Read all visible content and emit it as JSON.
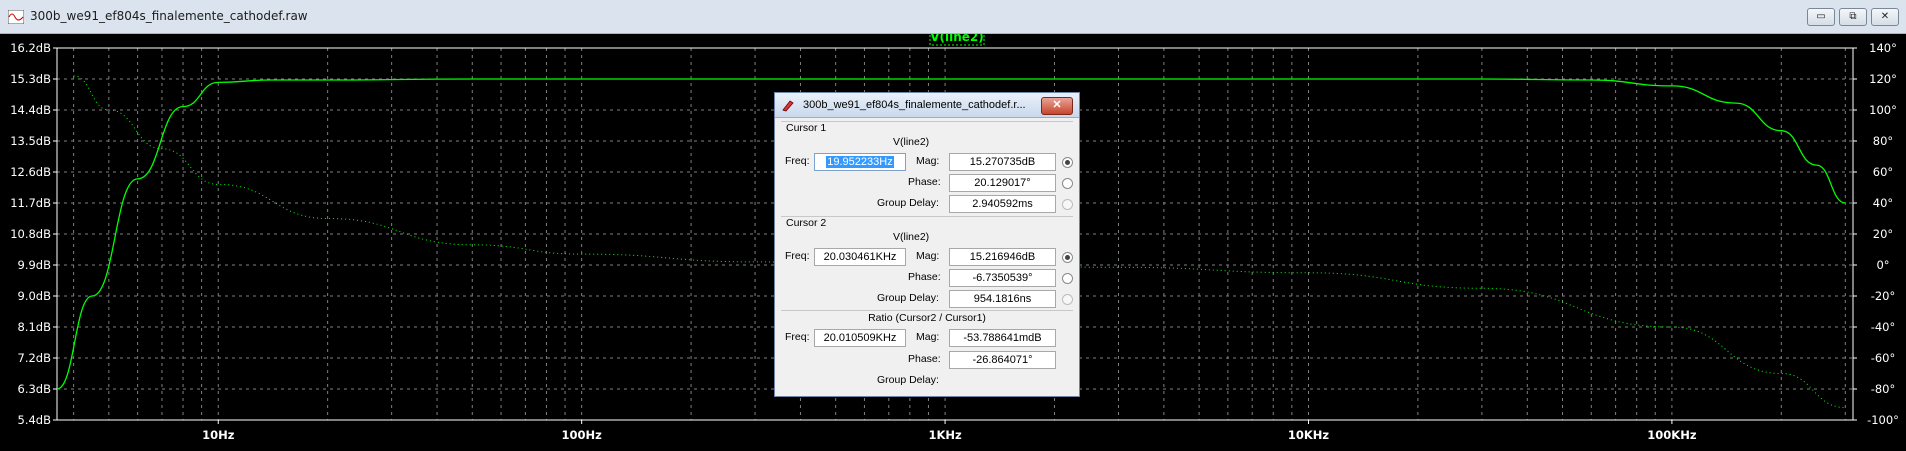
{
  "window": {
    "title": "300b_we91_ef804s_finalemente_cathodef.raw",
    "controls": [
      "▭",
      "⧉",
      "✕"
    ]
  },
  "plot": {
    "trace_label": "V(line2)",
    "colors": {
      "background": "#000000",
      "trace": "#00ff00",
      "grid": "#808080",
      "text": "#ffffff"
    },
    "y_left_ticks": [
      "16.2dB",
      "15.3dB",
      "14.4dB",
      "13.5dB",
      "12.6dB",
      "11.7dB",
      "10.8dB",
      "9.9dB",
      "9.0dB",
      "8.1dB",
      "7.2dB",
      "6.3dB",
      "5.4dB"
    ],
    "y_right_ticks": [
      "140°",
      "120°",
      "100°",
      "80°",
      "60°",
      "40°",
      "20°",
      "0°",
      "-20°",
      "-40°",
      "-60°",
      "-80°",
      "-100°"
    ],
    "x_ticks": [
      "10Hz",
      "100Hz",
      "1KHz",
      "10KHz",
      "100KHz"
    ]
  },
  "chart_data": {
    "type": "line",
    "x_scale": "log",
    "xlim_hz": [
      3.6,
      315000
    ],
    "ylim_db": [
      5.4,
      16.2
    ],
    "ylim_phase_deg": [
      -100,
      140
    ],
    "series": [
      {
        "name": "V(line2)",
        "style": "solid",
        "x": [
          3.6,
          4.5,
          6,
          8,
          10,
          14,
          20,
          50,
          1000,
          30000,
          60000,
          100000,
          150000,
          200000,
          250000,
          300000
        ],
        "y": [
          6.3,
          9.0,
          12.4,
          14.5,
          15.2,
          15.27,
          15.27,
          15.3,
          15.3,
          15.3,
          15.27,
          15.1,
          14.6,
          13.8,
          12.8,
          11.7
        ]
      },
      {
        "name": "V(line2) phase",
        "style": "dotted",
        "x": [
          4,
          5,
          7,
          10,
          20,
          50,
          100,
          300,
          1000,
          3000,
          10000,
          30000,
          100000,
          200000,
          300000
        ],
        "y": [
          122,
          100,
          75,
          52,
          30,
          13,
          7,
          2,
          0,
          -1.5,
          -5,
          -15,
          -40,
          -70,
          -92
        ]
      }
    ]
  },
  "dialog": {
    "title": "300b_we91_ef804s_finalemente_cathodef.r...",
    "close": "✕",
    "cursor1": {
      "heading": "Cursor 1",
      "trace": "V(line2)",
      "freq_label": "Freq:",
      "freq": "19.952233Hz",
      "mag_label": "Mag:",
      "mag": "15.270735dB",
      "phase_label": "Phase:",
      "phase": "20.129017°",
      "gd_label": "Group Delay:",
      "gd": "2.940592ms"
    },
    "cursor2": {
      "heading": "Cursor 2",
      "trace": "V(line2)",
      "freq_label": "Freq:",
      "freq": "20.030461KHz",
      "mag_label": "Mag:",
      "mag": "15.216946dB",
      "phase_label": "Phase:",
      "phase": "-6.7350539°",
      "gd_label": "Group Delay:",
      "gd": "954.1816ns"
    },
    "ratio": {
      "heading": "Ratio (Cursor2 / Cursor1)",
      "freq_label": "Freq:",
      "freq": "20.010509KHz",
      "mag_label": "Mag:",
      "mag": "-53.788641mdB",
      "phase_label": "Phase:",
      "phase": "-26.864071°",
      "gd_label": "Group Delay:"
    }
  }
}
